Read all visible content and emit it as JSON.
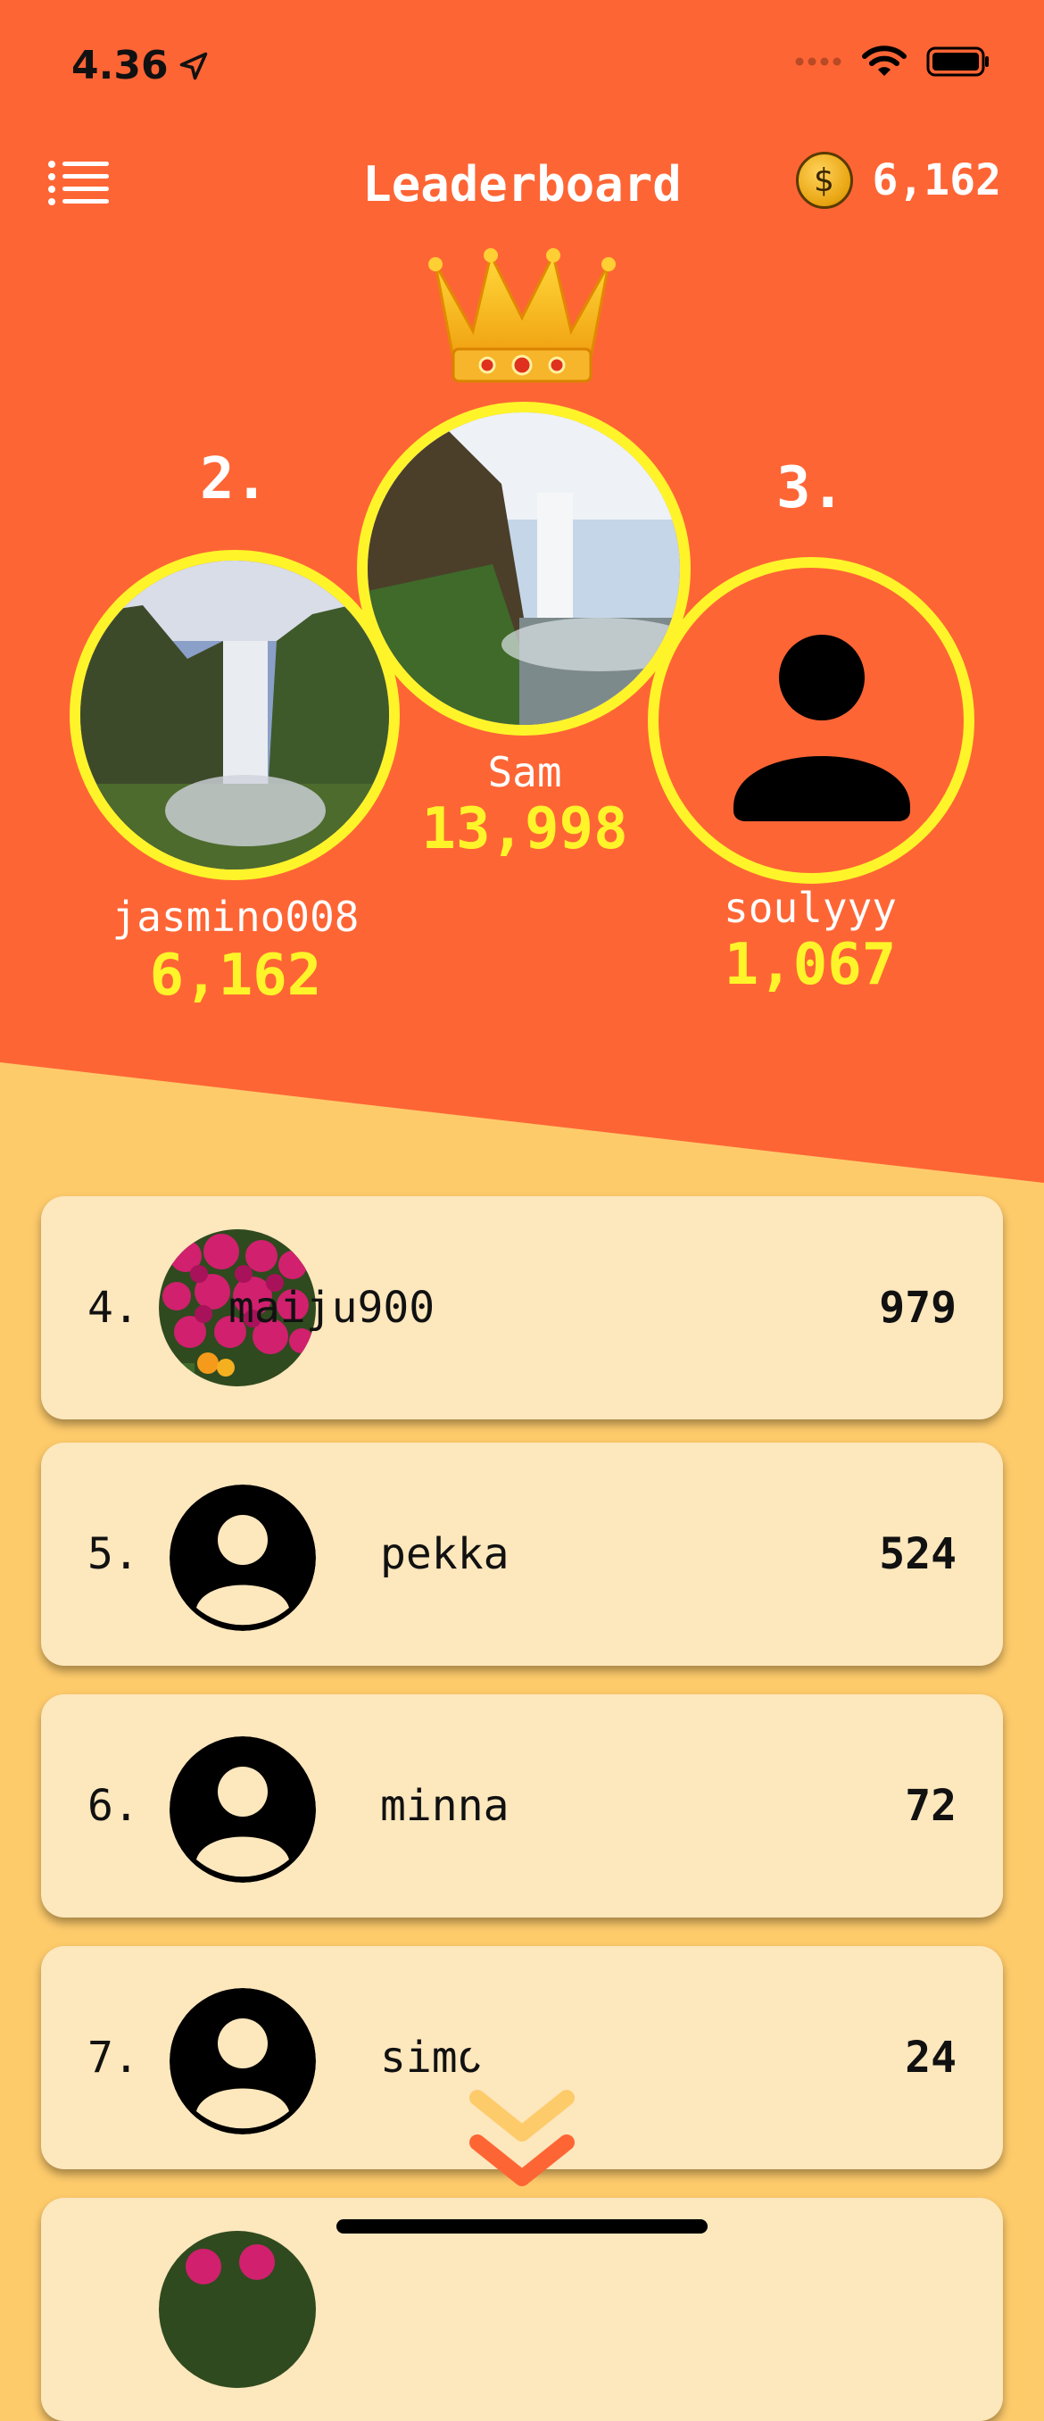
{
  "status": {
    "time": "4.36"
  },
  "header": {
    "title": "Leaderboard",
    "coins": "6,162"
  },
  "podium": {
    "first": {
      "name": "Sam",
      "score": "13,998"
    },
    "second": {
      "rank": "2.",
      "name": "jasmino008",
      "score": "6,162"
    },
    "third": {
      "rank": "3.",
      "name": "soulyyy",
      "score": "1,067"
    }
  },
  "list": [
    {
      "rank": "4.",
      "name": "maiju900",
      "score": "979",
      "avatar": "flowers-photo"
    },
    {
      "rank": "5.",
      "name": "pekka",
      "score": "524",
      "avatar": "default-user"
    },
    {
      "rank": "6.",
      "name": "minna",
      "score": "72",
      "avatar": "default-user"
    },
    {
      "rank": "7.",
      "name": "simo",
      "score": "24",
      "avatar": "default-user"
    }
  ],
  "colors": {
    "hero": "#fe6535",
    "background": "#fecb6b",
    "card": "#fde7bd",
    "highlight": "#fff42a"
  }
}
